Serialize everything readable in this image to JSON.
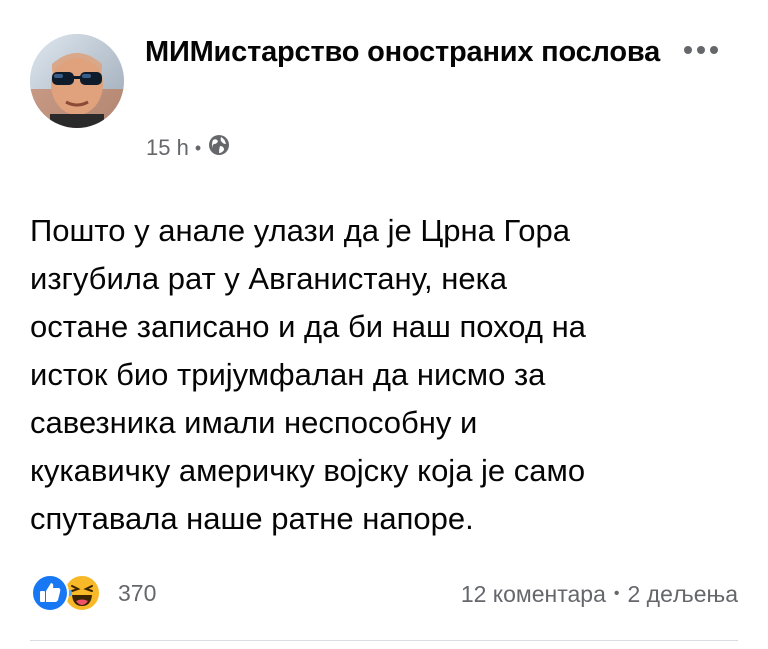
{
  "post": {
    "author": "МИМистарство оностраних послова",
    "timestamp": "15 h",
    "audience_icon": "globe-icon",
    "body": "Пошто у анале улази да је Црна Гора\nизгубила рат у Авганистану, нека\nостане записано и да би наш поход на\nисток био тријумфалан да нисмо за\nсавезника имали неспособну и\nкукавичку америчку војску која је само\nспутавала наше ратне напоре.",
    "reactions": {
      "icons": [
        "like-icon",
        "haha-icon"
      ],
      "count": "370"
    },
    "comments": "12 коментара",
    "shares": "2 дељења",
    "separator": "•"
  },
  "colors": {
    "like_blue": "#1877f2",
    "haha_yellow": "#f7b928",
    "secondary_text": "#65676b",
    "primary_text": "#050505"
  }
}
